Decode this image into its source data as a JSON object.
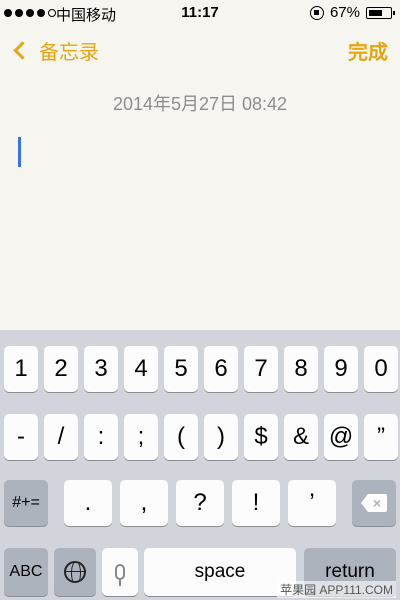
{
  "status": {
    "carrier": "中国移动",
    "time": "11:17",
    "battery": "67%",
    "battery_level": 0.67
  },
  "nav": {
    "back_label": "备忘录",
    "done_label": "完成"
  },
  "note": {
    "date": "2014年5月27日 08:42"
  },
  "keyboard": {
    "row1": [
      "1",
      "2",
      "3",
      "4",
      "5",
      "6",
      "7",
      "8",
      "9",
      "0"
    ],
    "row2": [
      "-",
      "/",
      ":",
      ";",
      "(",
      ")",
      "$",
      "&",
      "@",
      "”"
    ],
    "row3": [
      "#+=",
      ".",
      ",",
      "?",
      "!",
      "’"
    ],
    "abc": "ABC",
    "space": "space",
    "return": "return"
  },
  "watermark": "苹果园 APP111.COM",
  "colors": {
    "accent": "#e5a60f",
    "cursor": "#3b6ff5",
    "keyboard_bg": "#d1d5db"
  }
}
